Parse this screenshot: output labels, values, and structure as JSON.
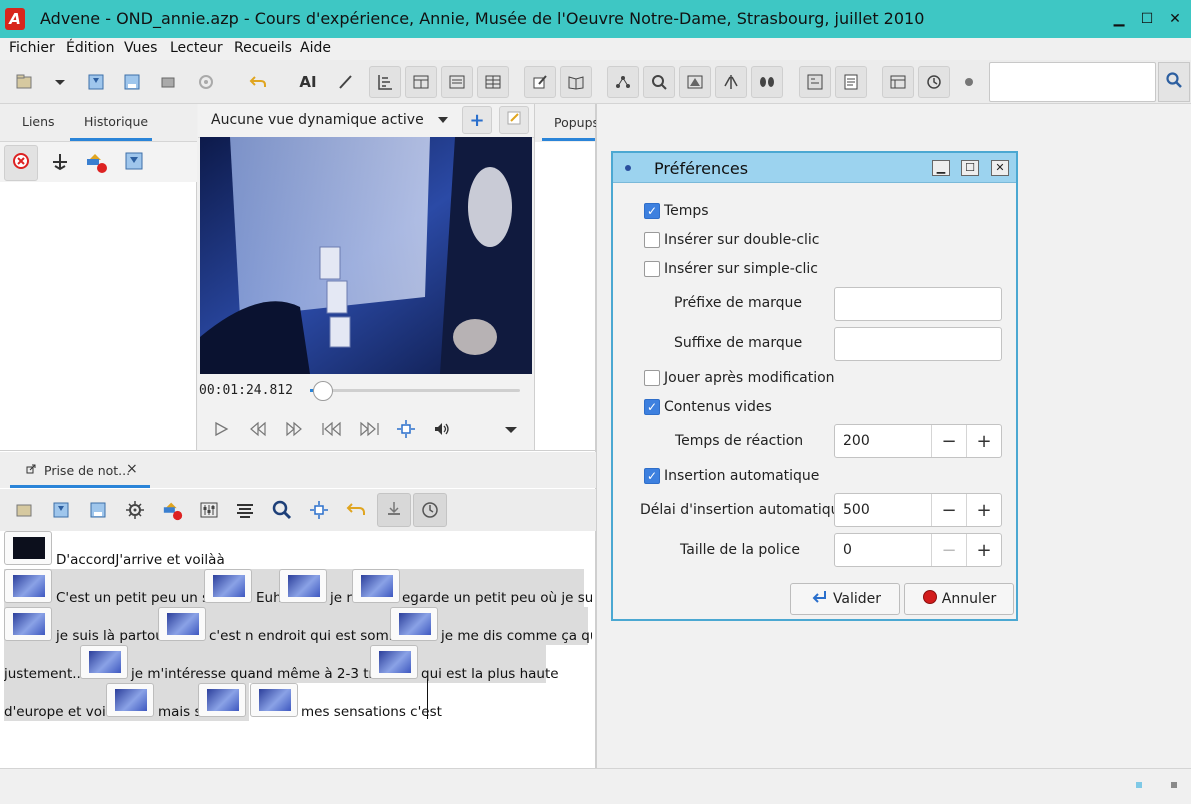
{
  "window": {
    "title": "Advene - OND_annie.azp - Cours d'expérience, Annie, Musée de l'Oeuvre Notre-Dame, Strasbourg, juillet 2010",
    "logo_letter": "A",
    "minimize": "▁",
    "maximize": "☐",
    "close": "✕"
  },
  "menu": [
    "Fichier",
    "Édition",
    "Vues",
    "Lecteur",
    "Recueils",
    "Aide"
  ],
  "toolbar": {
    "text_label": "AI",
    "icons": [
      "open-package-icon",
      "dropdown-icon",
      "save-icon",
      "save-as-icon",
      "import-icon",
      "disabled-icon",
      "undo-icon",
      "text-icon",
      "edit-pen-icon",
      "timeline-icon",
      "table-icon",
      "browser-icon",
      "grid-icon",
      "note-edit-icon",
      "book-icon",
      "network-icon",
      "zoom-icon",
      "annotate-icon",
      "compare-icon",
      "eyes-icon",
      "query-icon",
      "list-icon",
      "panel-icon",
      "clock-icon",
      "record-icon"
    ],
    "search_value": ""
  },
  "left_panel": {
    "tabs": [
      {
        "label": "Liens",
        "active": false
      },
      {
        "label": "Historique",
        "active": true
      }
    ]
  },
  "video": {
    "dynamic_view": "Aucune vue dynamique active",
    "time": "00:01:24.812",
    "progress": 0.06
  },
  "popups_panel": {
    "tab": "Popups"
  },
  "notes": {
    "tab_label": "Prise de not...",
    "close": "×",
    "lines": [
      [
        "D'accordJ'arrive et voilàà"
      ],
      [
        "C'est un petit peu un sas",
        "Euh",
        "je r",
        "egarde un petit peu où je suis"
      ],
      [
        "je suis là partout",
        "c'est n endroit qui est sombre",
        "je me dis comme ça que"
      ],
      [
        "justement...",
        "je m'intéresse quand même à 2-3 trucs",
        "qui est la plus  haute"
      ],
      [
        "d'europe et voilà",
        "mais si",
        "mes sensations c'est"
      ]
    ]
  },
  "prefs": {
    "title": "Préférences",
    "temps": {
      "label": "Temps",
      "checked": true
    },
    "inserer_double": {
      "label": "Insérer sur double-clic",
      "checked": false
    },
    "inserer_simple": {
      "label": "Insérer sur simple-clic",
      "checked": false
    },
    "prefixe": {
      "label": "Préfixe de marque",
      "value": ""
    },
    "suffixe": {
      "label": "Suffixe de marque",
      "value": ""
    },
    "jouer": {
      "label": "Jouer après modification",
      "checked": false
    },
    "contenus": {
      "label": "Contenus vides",
      "checked": true
    },
    "temps_reaction": {
      "label": "Temps de réaction",
      "value": "200"
    },
    "insertion_auto": {
      "label": "Insertion automatique",
      "checked": true
    },
    "delai": {
      "label": "Délai d'insertion automatique",
      "value": "500"
    },
    "taille": {
      "label": "Taille de la police",
      "value": "0"
    },
    "minus": "−",
    "plus": "+",
    "valider": "Valider",
    "annuler": "Annuler"
  }
}
